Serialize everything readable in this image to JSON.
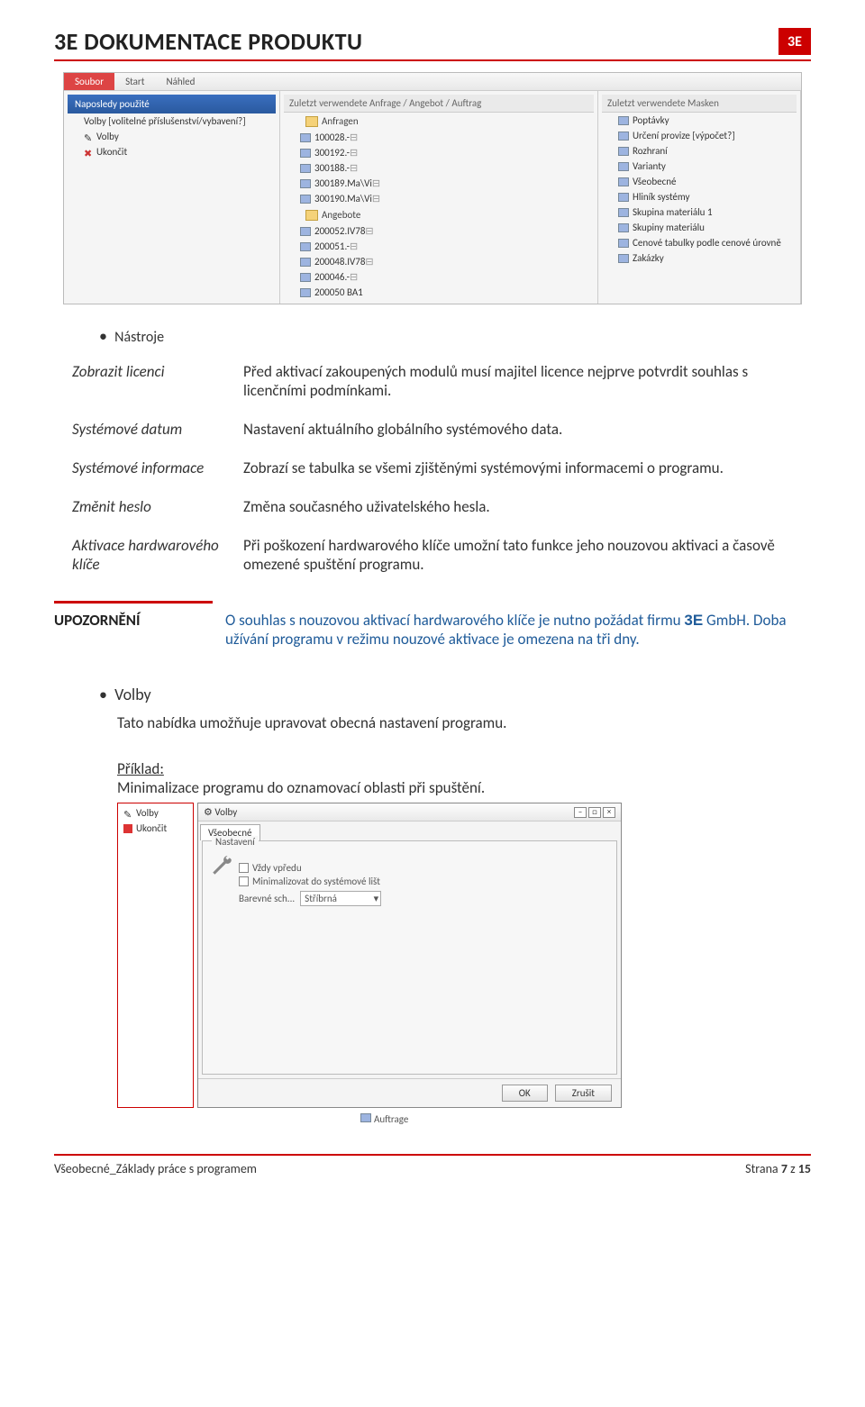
{
  "header": {
    "title": "3E DOKUMENTACE PRODUKTU",
    "logo": "3E"
  },
  "screenshot1": {
    "tabs": [
      "Soubor",
      "Start",
      "Náhled"
    ],
    "recent_label": "Naposledy použité",
    "left_items": [
      "Volby [volitelné příslušenství/vybavení?]",
      "Volby",
      "Ukončit"
    ],
    "mid_header": "Zuletzt verwendete Anfrage / Angebot / Auftrag",
    "mid_group1": "Anfragen",
    "mid_items1": [
      "100028.-",
      "300192.-",
      "300188.-",
      "300189.Ma\\Vi",
      "300190.Ma\\Vi"
    ],
    "mid_group2": "Angebote",
    "mid_items2": [
      "200052.IV78",
      "200051.-",
      "200048.IV78",
      "200046.-",
      "200050 BA1"
    ],
    "right_header": "Zuletzt verwendete Masken",
    "right_items": [
      "Poptávky",
      "Určení provize [výpočet?]",
      "Rozhraní",
      "Varianty",
      "Všeobecné",
      "Hliník systémy",
      "Skupina materiálu 1",
      "Skupiny materiálu",
      "Cenové tabulky podle cenové úrovně",
      "Zakázky"
    ]
  },
  "tools_bullet": "Nástroje",
  "definitions": [
    {
      "term": "Zobrazit licenci",
      "desc": "Před aktivací zakoupených modulů musí majitel licence nejprve potvrdit souhlas s licenčními podmínkami."
    },
    {
      "term": "Systémové datum",
      "desc": "Nastavení aktuálního globálního systémového data."
    },
    {
      "term": "Systémové informace",
      "desc": "Zobrazí se tabulka se všemi zjištěnými systémovými informacemi o programu."
    },
    {
      "term": "Změnit heslo",
      "desc": "Změna současného uživatelského hesla."
    },
    {
      "term": "Aktivace hardwarového klíče",
      "desc": "Při poškození hardwarového klíče umožní tato funkce jeho nouzovou aktivaci a časově omezené spuštění programu."
    }
  ],
  "notice": {
    "label": "UPOZORNĚNÍ",
    "text_pre": "O souhlas s nouzovou aktivací hardwarového klíče je nutno požádat firmu ",
    "brand": "3E",
    "text_post": " GmbH. Doba užívání programu v režimu nouzové aktivace je omezena na tři dny."
  },
  "volby": {
    "bullet": "Volby",
    "desc": "Tato nabídka umožňuje upravovat obecná nastavení programu.",
    "example_label": "Příklad:",
    "example_text": "Minimalizace programu do oznamovací oblasti při spuštění."
  },
  "screenshot2": {
    "menu": [
      "Volby",
      "Ukončit"
    ],
    "win_title": "Volby",
    "tab": "Všeobecné",
    "group_title": "Nastavení",
    "chk1": "Vždy vpředu",
    "chk2": "Minimalizovat do systémové lišt",
    "scheme_label": "Barevné sch...",
    "scheme_value": "Stříbrná",
    "ok": "OK",
    "cancel": "Zrušit",
    "tiny": "Auftrage"
  },
  "footer": {
    "left": "Všeobecné_Základy práce s programem",
    "right_pre": "Strana ",
    "page": "7",
    "right_mid": " z ",
    "total": "15"
  }
}
